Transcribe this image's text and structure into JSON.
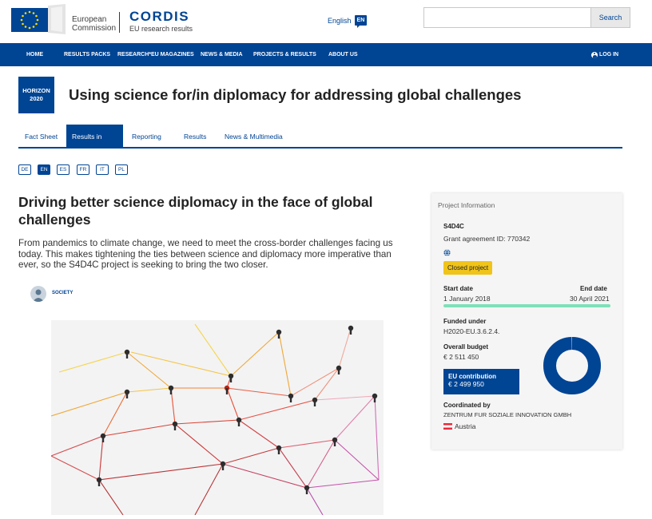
{
  "header": {
    "ec_line1": "European",
    "ec_line2": "Commission",
    "cordis": "CORDIS",
    "cordis_sub": "EU research results",
    "language": "English",
    "language_code": "EN",
    "search_placeholder": "",
    "search_button": "Search"
  },
  "nav": {
    "items": [
      "HOME",
      "RESULTS PACKS",
      "RESEARCH*EU MAGAZINES",
      "NEWS & MEDIA",
      "PROJECTS & RESULTS",
      "ABOUT US"
    ],
    "login": "LOG IN"
  },
  "programme_badge": {
    "line1": "HORIZON",
    "line2": "2020"
  },
  "page_title": "Using science for/in diplomacy for addressing global challenges",
  "tabs": [
    {
      "label": "Fact Sheet",
      "active": false
    },
    {
      "label": "Results in Brief",
      "active": true
    },
    {
      "label": "Reporting",
      "active": false
    },
    {
      "label": "Results",
      "active": false
    },
    {
      "label": "News & Multimedia",
      "active": false
    }
  ],
  "languages": [
    "DE",
    "EN",
    "ES",
    "FR",
    "IT",
    "PL"
  ],
  "active_language": "EN",
  "article": {
    "title": "Driving better science diplomacy in the face of global challenges",
    "lead": "From pandemics to climate change, we need to meet the cross-border challenges facing us today. This makes tightening the ties between science and diplomacy more imperative than ever, so the S4D4C project is seeking to bring the two closer.",
    "tag": "SOCIETY"
  },
  "project_info": {
    "heading": "Project Information",
    "acronym": "S4D4C",
    "grant": "Grant agreement ID: 770342",
    "status": "Closed project",
    "start_label": "Start date",
    "start": "1 January 2018",
    "end_label": "End date",
    "end": "30 April 2021",
    "funded_label": "Funded under",
    "funded": "H2020-EU.3.6.2.4.",
    "budget_label": "Overall budget",
    "budget": "€ 2 511 450",
    "contribution_label": "EU contribution",
    "contribution": "€ 2 499 950",
    "coordinated_label": "Coordinated by",
    "coordinator": "ZENTRUM FUR SOZIALE INNOVATION GMBH",
    "country": "Austria",
    "contribution_share": 0.9954
  },
  "colors": {
    "brand_blue": "#004494",
    "closed_badge": "#f0c419",
    "timeline_bar": "#7ee0b9"
  }
}
